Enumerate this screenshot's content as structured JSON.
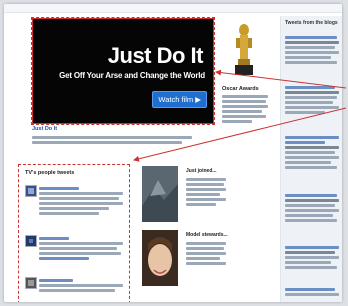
{
  "hero": {
    "title": "Just Do It",
    "subtitle": "Get Off Your Arse and Change the World",
    "watch_button": "Watch film ▶"
  },
  "hero_caption": {
    "link": "Just Do It"
  },
  "trophy": {
    "label": "Oscar Awards"
  },
  "sidebar": {
    "title": "Tweets from the blogs"
  },
  "tweets_box": {
    "title": "TV's people tweets"
  },
  "cards": [
    {
      "title": "Just joined..."
    },
    {
      "title": "Model stewards..."
    }
  ],
  "colors": {
    "accent_blue": "#1f6fd1",
    "annotation_red": "#cc3333",
    "hero_bg": "#050505"
  }
}
